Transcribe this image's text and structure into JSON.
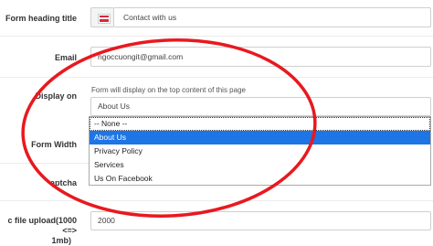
{
  "form": {
    "heading_title_label": "Form heading title",
    "heading_title_value": "Contact with us",
    "email_label": "Email",
    "email_value": "ngoccuongit@gmail.com",
    "display_on_label": "Display on",
    "display_on_hint": "Form will display on the top content of this page",
    "display_on_selected": "About Us",
    "display_on_options": [
      "-- None --",
      "About Us",
      "Privacy Policy",
      "Services",
      "Us On Facebook"
    ],
    "form_width_label": "Form Width",
    "captcha_label": "aptcha",
    "file_upload_label_line1": "c file upload(1000 <=>",
    "file_upload_label_line2": "1mb)",
    "file_upload_value": "2000"
  },
  "colors": {
    "annotation_oval": "#e8191f",
    "selected_option_bg": "#1e75e6"
  },
  "icons": {
    "language_flag": "flag-icon"
  }
}
